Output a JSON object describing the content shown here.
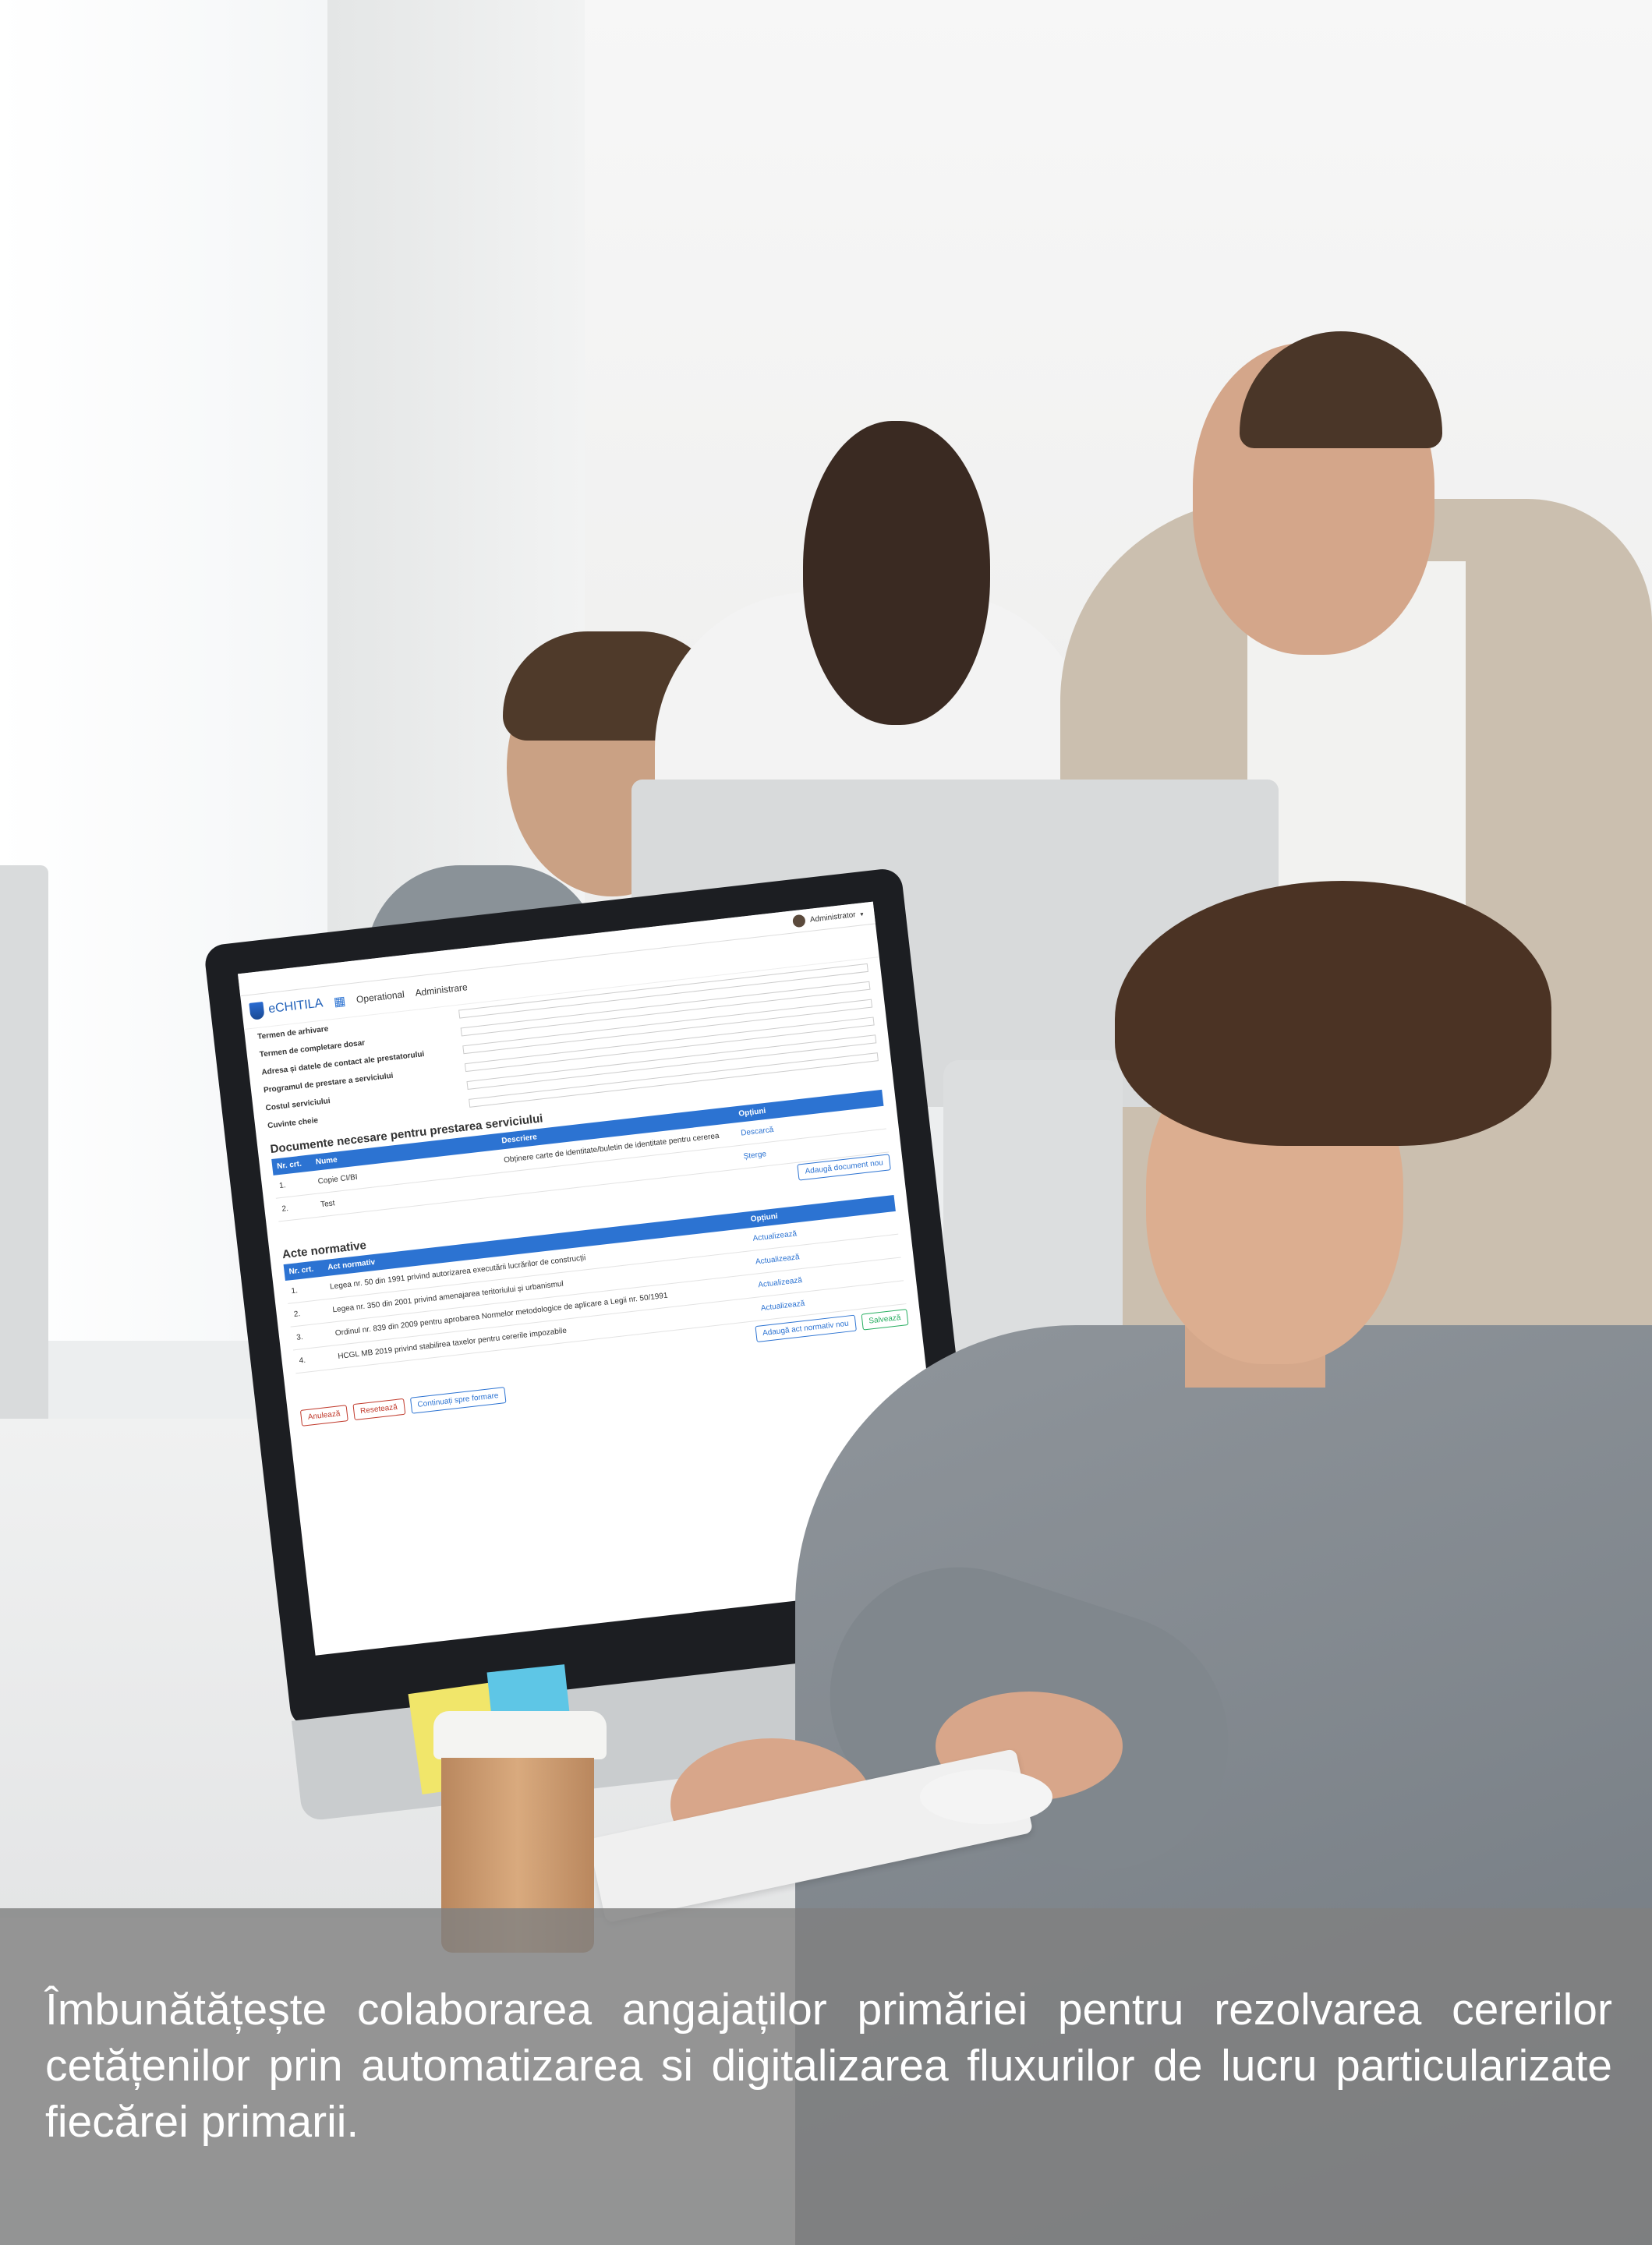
{
  "caption": "Îmbunătățește colaborarea angajaților primăriei pentru rezolvarea cererilor cetățenilor prin automatizarea si digitalizarea fluxurilor de lucru particularizate fiecărei primarii.",
  "screen": {
    "user": "Administrator",
    "logo_text": "eCHITILA",
    "nav": [
      "Operational",
      "Administrare"
    ],
    "form_labels": [
      "Termen de arhivare",
      "Termen de completare dosar",
      "Adresa și datele de contact ale prestatorului",
      "Programul de prestare a serviciului",
      "Costul serviciului",
      "Cuvinte cheie"
    ],
    "section_documents": "Documente necesare pentru prestarea serviciului",
    "documents_header": [
      "Nr. crt.",
      "Nume",
      "Descriere",
      "Opțiuni"
    ],
    "documents_rows": [
      {
        "nr": "1.",
        "name": "Copie CI/BI",
        "desc": "Obținere carte de identitate/buletin de identitate pentru cererea"
      },
      {
        "nr": "2.",
        "name": "Test",
        "desc": ""
      }
    ],
    "section_acts": "Acte normative",
    "acts_header": [
      "Nr. crt.",
      "Act normativ",
      "Opțiuni"
    ],
    "acts_rows": [
      {
        "nr": "1.",
        "act": "Legea nr. 50 din 1991 privind autorizarea executării lucrărilor de construcții"
      },
      {
        "nr": "2.",
        "act": "Legea nr. 350 din 2001 privind amenajarea teritoriului și urbanismul"
      },
      {
        "nr": "3.",
        "act": "Ordinul nr. 839 din 2009 pentru aprobarea Normelor metodologice de aplicare a Legii nr. 50/1991"
      },
      {
        "nr": "4.",
        "act": "HCGL MB 2019 privind stabilirea taxelor pentru cererile impozabile"
      }
    ],
    "actions": [
      "Descarcă",
      "Șterge",
      "Actualizează"
    ],
    "add_document": "Adaugă document nou",
    "add_act": "Adaugă act normativ nou",
    "save": "Salvează",
    "footer_buttons": [
      "Anulează",
      "Resetează",
      "Continuați spre formare"
    ]
  },
  "colors": {
    "band": "#808080",
    "caption_text": "#ffffff",
    "table_header": "#2c73d2"
  }
}
